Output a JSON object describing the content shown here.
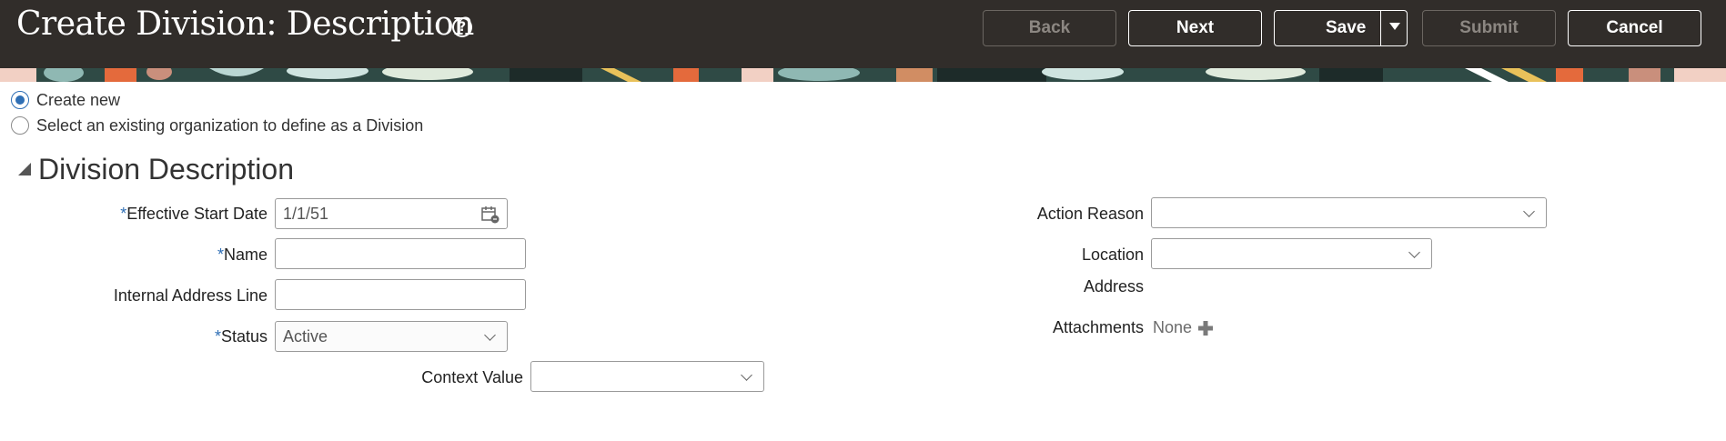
{
  "header": {
    "title": "Create Division: Description",
    "help_icon": "help-circle-icon",
    "buttons": {
      "back": "Back",
      "next": "Next",
      "save": "Save",
      "submit": "Submit",
      "cancel": "Cancel"
    }
  },
  "mode": {
    "options": [
      {
        "label": "Create new",
        "selected": true
      },
      {
        "label": "Select an existing organization to define as a Division",
        "selected": false
      }
    ]
  },
  "section": {
    "title": "Division Description"
  },
  "form": {
    "left": {
      "effective_start_date": {
        "label": "Effective Start Date",
        "required": "*",
        "value": "1/1/51"
      },
      "name": {
        "label": "Name",
        "required": "*",
        "value": ""
      },
      "internal_address_line": {
        "label": "Internal Address Line",
        "value": ""
      },
      "status": {
        "label": "Status",
        "required": "*",
        "value": "Active"
      },
      "context_value": {
        "label": "Context Value",
        "value": ""
      }
    },
    "right": {
      "action_reason": {
        "label": "Action Reason",
        "value": ""
      },
      "location": {
        "label": "Location",
        "value": ""
      },
      "address": {
        "label": "Address"
      },
      "attachments": {
        "label": "Attachments",
        "value": "None"
      }
    }
  },
  "colors": {
    "header_bg": "#312d2a",
    "accent": "#2f6fb5"
  }
}
